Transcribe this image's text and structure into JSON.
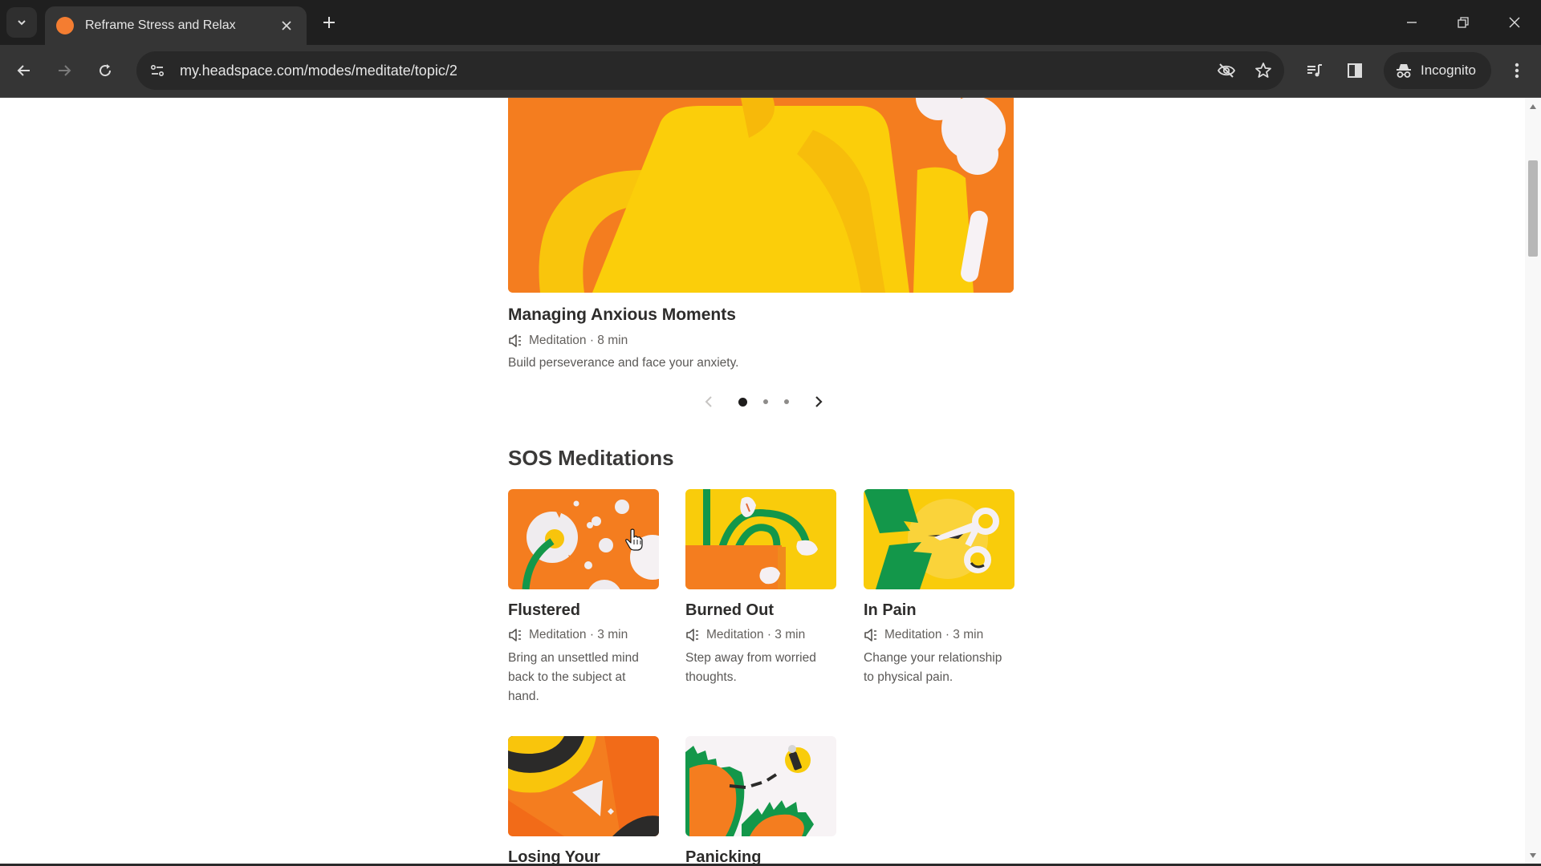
{
  "browser": {
    "tab": {
      "title": "Reframe Stress and Relax",
      "favicon_color": "#f47d31"
    },
    "address": {
      "url": "my.headspace.com/modes/meditate/topic/2"
    },
    "profile_label": "Incognito",
    "icons": {
      "tab_list": "chevron-down-icon",
      "close_tab": "close-icon",
      "new_tab": "plus-icon",
      "back": "arrow-left-icon",
      "forward": "arrow-right-icon",
      "reload": "reload-icon",
      "site_info": "tune-icon",
      "tracking": "eye-off-icon",
      "bookmark": "star-icon",
      "media": "media-queue-icon",
      "side_panel": "side-panel-icon",
      "incognito": "incognito-icon",
      "menu": "more-vert-icon",
      "minimize": "minimize-icon",
      "restore": "restore-icon",
      "close_window": "close-icon"
    }
  },
  "featured": {
    "title": "Managing Anxious Moments",
    "type": "Meditation",
    "separator": "·",
    "duration": "8 min",
    "meta": "Meditation · 8 min",
    "description": "Build perseverance and face your anxiety.",
    "carousel": {
      "total": 3,
      "active_index": 0,
      "prev_enabled": false,
      "next_enabled": true
    }
  },
  "sos": {
    "heading": "SOS Meditations",
    "cards": [
      {
        "title": "Flustered",
        "meta": "Meditation · 3 min",
        "description": "Bring an unsettled mind back to the subject at hand."
      },
      {
        "title": "Burned Out",
        "meta": "Meditation · 3 min",
        "description": "Step away from worried thoughts."
      },
      {
        "title": "In Pain",
        "meta": "Meditation · 3 min",
        "description": "Change your relationship to physical pain."
      },
      {
        "title": "Losing Your",
        "meta": "",
        "description": ""
      },
      {
        "title": "Panicking",
        "meta": "",
        "description": ""
      }
    ]
  },
  "colors": {
    "orange": "#f47d1f",
    "yellow": "#f9cc0b",
    "green": "#129846",
    "text": "#2d2c2b"
  }
}
